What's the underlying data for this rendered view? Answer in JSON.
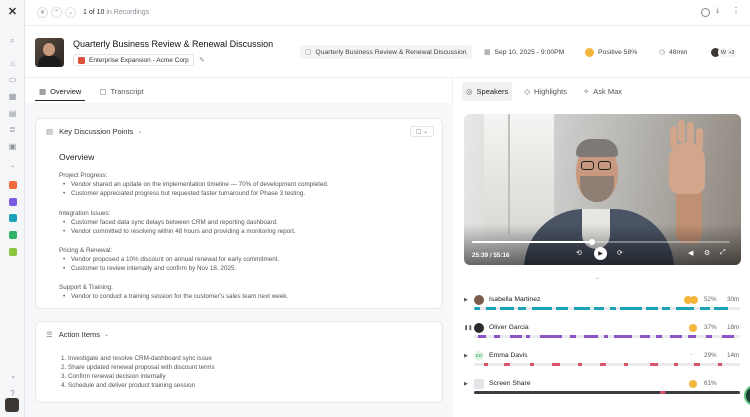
{
  "topbar": {
    "record_position": "1 of 10",
    "record_context": "in Recordings"
  },
  "header": {
    "title": "Quarterly Business Review & Renewal Discussion",
    "deal_chip": "Enterprise Expansion - Acme Corp",
    "meeting_tag": "Quarterly Business Review & Renewal Discussion",
    "date": "Sep 10, 2025 - 9:00PM",
    "sentiment": "Positive 58%",
    "duration": "48min",
    "participants_initial": "W",
    "participants_more": "+3"
  },
  "left_tabs": [
    {
      "label": "Overview",
      "active": true
    },
    {
      "label": "Transcript",
      "active": false
    }
  ],
  "key_points": {
    "heading": "Key Discussion Points",
    "overview_title": "Overview",
    "sections": [
      {
        "title": "Project Progress:",
        "bullets": [
          "Vendor shared an update on the implementation timeline — 70% of development completed.",
          "Customer appreciated progress but requested faster turnaround for Phase 3 testing."
        ]
      },
      {
        "title": "Integration Issues:",
        "bullets": [
          "Customer faced data sync delays between CRM and reporting dashboard.",
          "Vendor committed to resolving within 48 hours and providing a monitoring report."
        ]
      },
      {
        "title": "Pricing & Renewal:",
        "bullets": [
          "Vendor proposed a 10% discount on annual renewal for early commitment.",
          "Customer to review internally and confirm by Nov 18, 2025."
        ]
      },
      {
        "title": "Support & Training:",
        "bullets": [
          "Vendor to conduct a training session for the customer's sales team next week."
        ]
      }
    ]
  },
  "action_items": {
    "heading": "Action Items",
    "items": [
      "1. Investigate and resolve CRM-dashboard sync issue",
      "2. Share updated renewal proposal with discount terms",
      "3. Confirm renewal decision internally",
      "4. Schedule and deliver product training session"
    ]
  },
  "right_tabs": [
    {
      "label": "Speakers",
      "active": true
    },
    {
      "label": "Highlights",
      "active": false
    },
    {
      "label": "Ask Max",
      "active": false
    }
  ],
  "player": {
    "current_time": "25:39",
    "total_time": "55:16",
    "progress": 0.4643
  },
  "speakers": [
    {
      "name": "Isabella Martinez",
      "percent": "52%",
      "duration": "30m",
      "avatar_color": "#7a5c4a",
      "track_color": "#1aa3b8",
      "mood_count": 2
    },
    {
      "name": "Oliver Garcia",
      "percent": "37%",
      "duration": "18m",
      "avatar_color": "#2b2b2b",
      "track_color": "#8e55c9",
      "mood_count": 1
    },
    {
      "name": "Emma Davis",
      "initials": "ED",
      "percent": "29%",
      "duration": "14m",
      "avatar_color": "#dff5e4",
      "track_color": "#d9546b",
      "mood_count": 0
    },
    {
      "name": "Screen Share",
      "percent": "61%",
      "duration": "",
      "avatar_color": "#e3e5e8",
      "track_color": "#3a3d42",
      "mood_count": 1
    }
  ],
  "colors": {
    "accent": "#1aa3b8",
    "sentiment": "#f3b63a",
    "fab_ring": "#5bbf82"
  }
}
